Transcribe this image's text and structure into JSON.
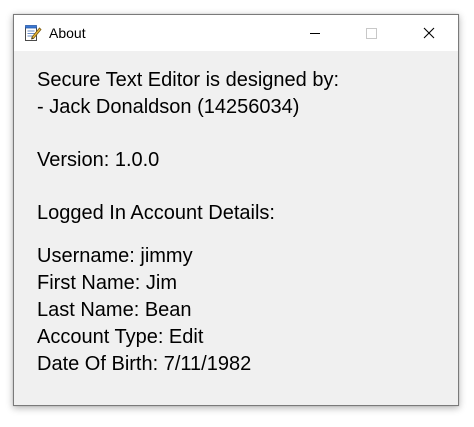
{
  "window": {
    "title": "About",
    "icon": "notepad-pencil-icon",
    "controls": {
      "minimize": "minimize-icon",
      "maximize": "maximize-icon",
      "close": "close-icon"
    }
  },
  "about": {
    "designed_by_heading": "Secure Text Editor is designed by:",
    "designer": "- Jack Donaldson (14256034)",
    "version": "Version: 1.0.0",
    "account_heading": "Logged In Account Details:",
    "username": "Username: jimmy",
    "first_name": "First Name: Jim",
    "last_name": "Last Name: Bean",
    "account_type": "Account Type: Edit",
    "date_of_birth": "Date Of Birth: 7/11/1982"
  }
}
